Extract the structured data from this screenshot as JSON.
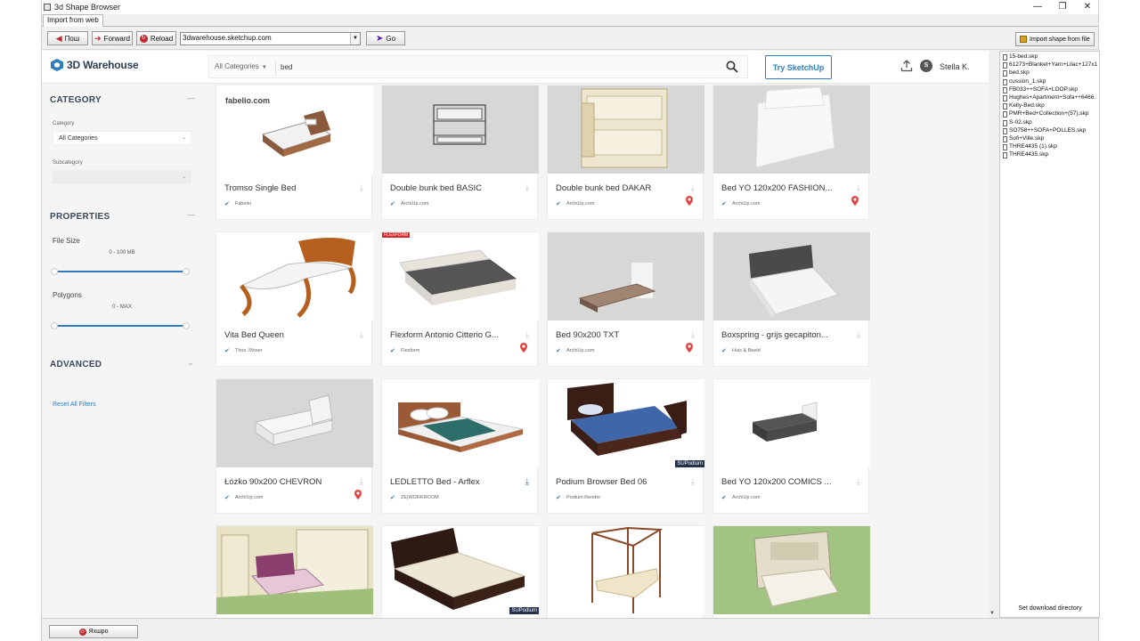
{
  "window": {
    "title": "3d Shape Browser",
    "tab": "Import from web"
  },
  "toolbar": {
    "back_label": "Пош",
    "forward_label": "Forward",
    "reload_label": "Reload",
    "url": "3dwarehouse.sketchup.com",
    "go_label": "Go",
    "import_label": "Import shape from file"
  },
  "header": {
    "logo": "3D Warehouse",
    "search_category": "All Categories",
    "search_query": "bed",
    "try_button": "Try SketchUp",
    "user": "Stella K.",
    "avatar_initial": "S"
  },
  "sidebar": {
    "category_title": "CATEGORY",
    "category_label": "Category",
    "category_value": "All Categories",
    "subcategory_label": "Subcategory",
    "properties_title": "PROPERTIES",
    "file_size_label": "File Size",
    "file_size_range": "0 - 100 MB",
    "polygons_label": "Polygons",
    "polygons_range": "0 - MAX",
    "advanced_title": "ADVANCED",
    "reset_link": "Reset All Filters"
  },
  "cards": [
    {
      "name": "Tromso Single Bed",
      "author": "Fabelio",
      "brand": "fabelio.com"
    },
    {
      "name": "Double bunk bed BASIC",
      "author": "ArchiUp.com"
    },
    {
      "name": "Double bunk bed DAKAR",
      "author": "ArchiUp.com"
    },
    {
      "name": "Bed YO 120x200 FASHION...",
      "author": "ArchiUp.com"
    },
    {
      "name": "Vita Bed Queen",
      "author": "Thos. Moser"
    },
    {
      "name": "Flexform Antonio Citterio G...",
      "author": "Flexform",
      "brand": "FLEXFORM"
    },
    {
      "name": "Bed 90x200 TXT",
      "author": "ArchiUp.com"
    },
    {
      "name": "Boxspring - grijs gecapiton...",
      "author": "Huis & Beeld"
    },
    {
      "name": "Łóżko 90x200 CHEVRON",
      "author": "ArchiUp.com"
    },
    {
      "name": "LEDLETTO Bed - Arflex",
      "author": "ZE|WORKROOM"
    },
    {
      "name": "Podium Browser Bed 06",
      "author": "Podium Render",
      "badge": "SUPodium"
    },
    {
      "name": "Bed YO 120x200 COMICS ...",
      "author": "ArchiUp.com"
    },
    {
      "name": "",
      "author": ""
    },
    {
      "name": "",
      "author": "",
      "badge": "SUPodium"
    },
    {
      "name": "",
      "author": ""
    },
    {
      "name": "",
      "author": ""
    }
  ],
  "files": [
    "15-bed.skp",
    "61273+Blanket+Yarn+Lilac+127x1",
    "bed.skp",
    "cussion_1.skp",
    "FB033++SOFA+LOOP.skp",
    "Hughes+Apartment+Sofa++6466.",
    "Kelly-Bed.skp",
    "PMR+Bed+Collection+(57).skp",
    "S-02.skp",
    "SO758++SOFA+POLLES.skp",
    "Sofi+Ville.skp",
    "THRE4435 (1).skp",
    "THRE4435.skp"
  ],
  "right_panel": {
    "dir_button": "Set download directory"
  },
  "status": {
    "exit_label": "Яхшро"
  },
  "colors": {
    "accent": "#2f7dc1",
    "pin": "#e04343"
  }
}
